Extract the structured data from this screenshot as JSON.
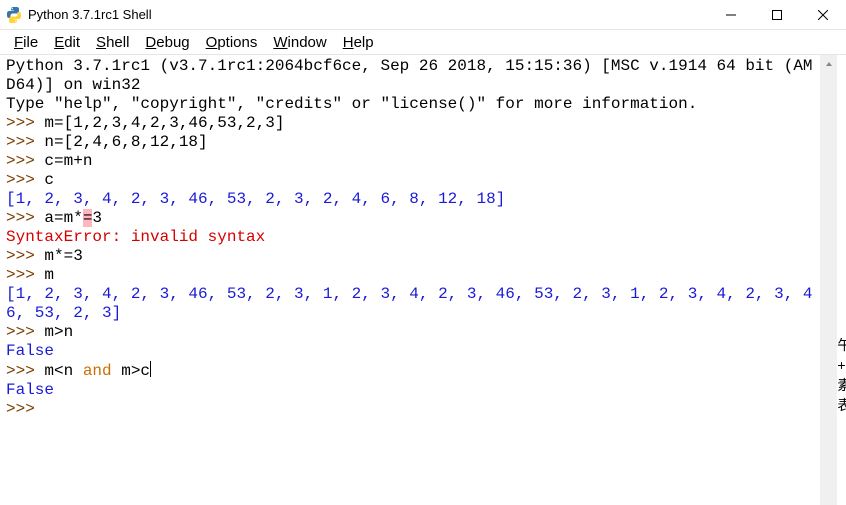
{
  "window": {
    "title": "Python 3.7.1rc1 Shell"
  },
  "menu": {
    "items": [
      {
        "label": "File",
        "accel": "F"
      },
      {
        "label": "Edit",
        "accel": "E"
      },
      {
        "label": "Shell",
        "accel": "S"
      },
      {
        "label": "Debug",
        "accel": "D"
      },
      {
        "label": "Options",
        "accel": "O"
      },
      {
        "label": "Window",
        "accel": "W"
      },
      {
        "label": "Help",
        "accel": "H"
      }
    ]
  },
  "console": {
    "banner_line1": "Python 3.7.1rc1 (v3.7.1rc1:2064bcf6ce, Sep 26 2018, 15:15:36) [MSC v.1914 64 bit (AMD64)] on win32",
    "banner_line2": "Type \"help\", \"copyright\", \"credits\" or \"license()\" for more information.",
    "prompt": ">>> ",
    "lines": {
      "l1": "m=[1,2,3,4,2,3,46,53,2,3]",
      "l2": "n=[2,4,6,8,12,18]",
      "l3": "c=m+n",
      "l4": "c",
      "out_c": "[1, 2, 3, 4, 2, 3, 46, 53, 2, 3, 2, 4, 6, 8, 12, 18]",
      "l5a": "a=m*",
      "l5hl": "=",
      "l5b": "3",
      "err": "SyntaxError: invalid syntax",
      "l6": "m*=3",
      "l7": "m",
      "out_m": "[1, 2, 3, 4, 2, 3, 46, 53, 2, 3, 1, 2, 3, 4, 2, 3, 46, 53, 2, 3, 1, 2, 3, 4, 2, 3, 46, 53, 2, 3]",
      "l8": "m>n",
      "out_false1": "False",
      "l9a": "m<n ",
      "l9kw": "and",
      "l9b": " m>c",
      "out_false2": "False"
    }
  },
  "sliver": {
    "chars": [
      "午",
      "+",
      "素",
      "表"
    ]
  }
}
